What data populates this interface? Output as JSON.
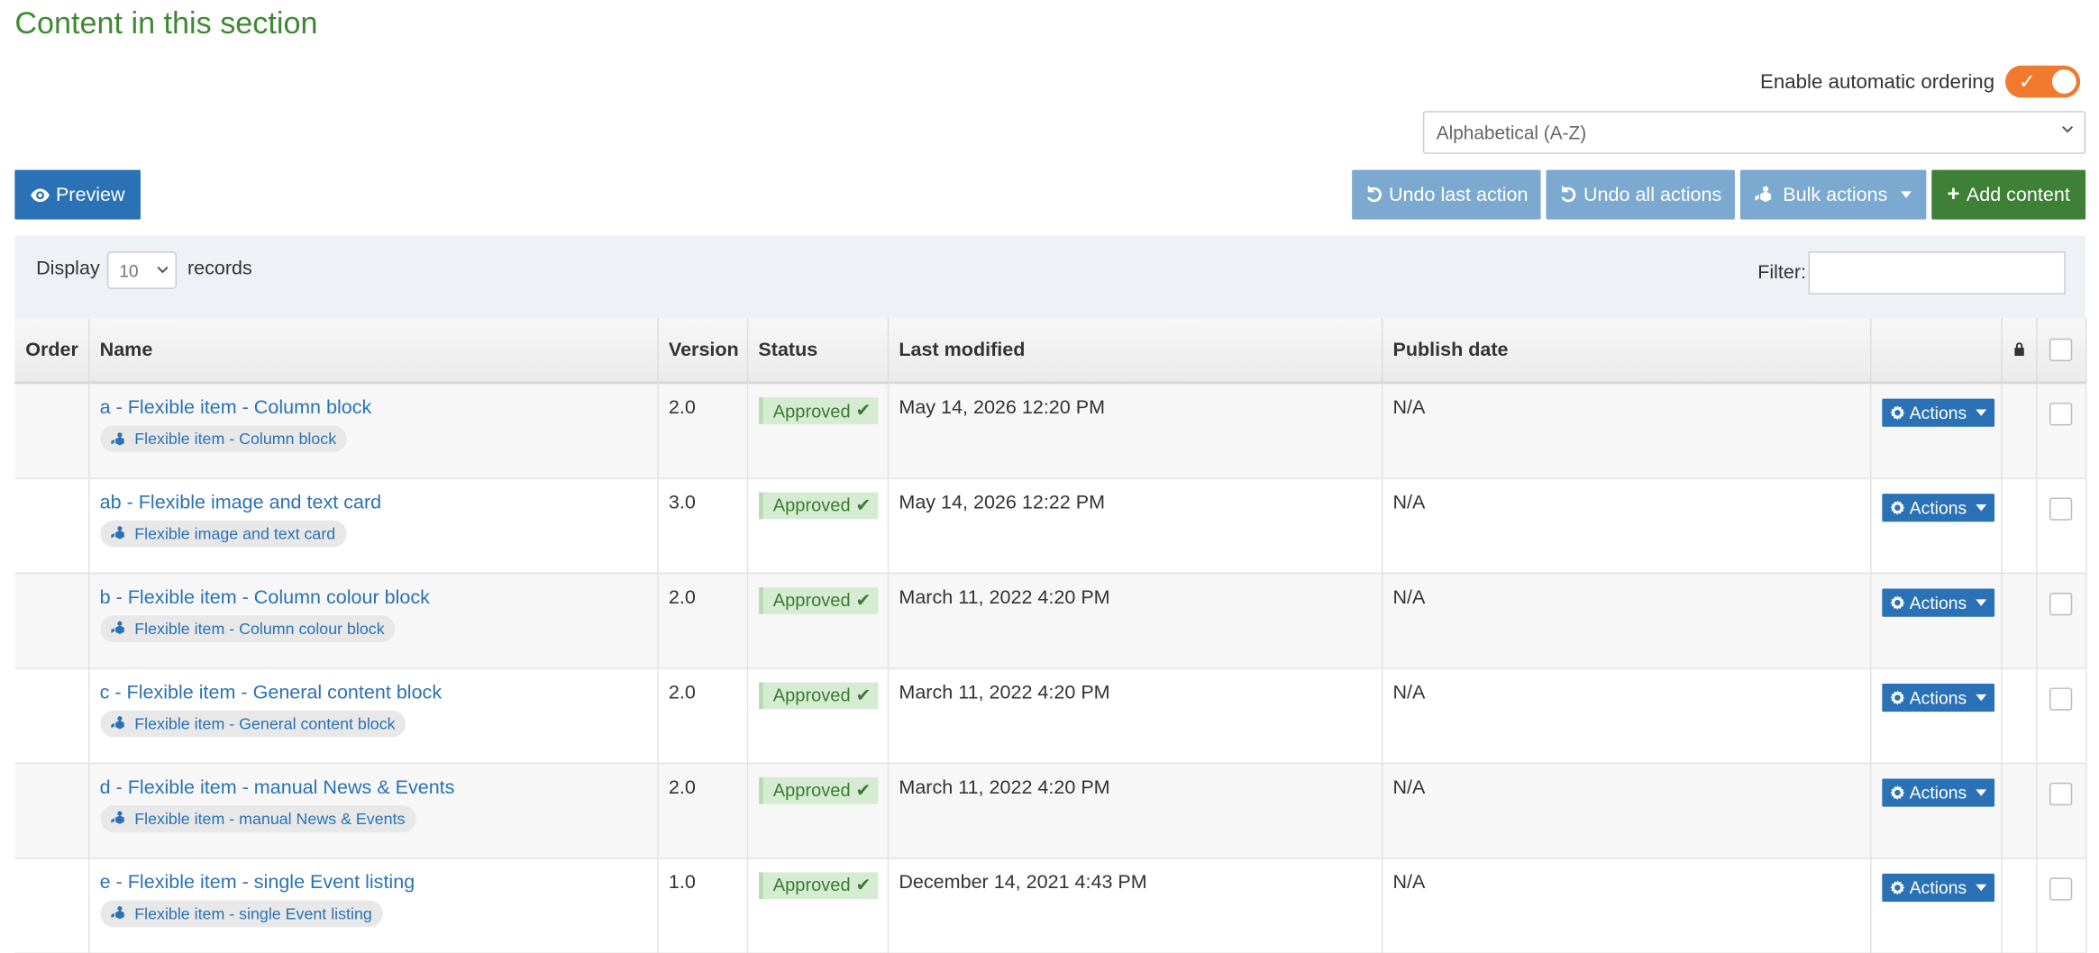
{
  "title": "Content in this section",
  "ordering": {
    "label": "Enable automatic ordering",
    "enabled": true,
    "sort_value": "Alphabetical (A-Z)"
  },
  "toolbar": {
    "preview": "Preview",
    "undo_last": "Undo last action",
    "undo_all": "Undo all actions",
    "bulk": "Bulk actions",
    "add": "Add content"
  },
  "filterbar": {
    "display_label": "Display",
    "display_value": "10",
    "records_label": "records",
    "filter_label": "Filter:"
  },
  "columns": {
    "order": "Order",
    "name": "Name",
    "version": "Version",
    "status": "Status",
    "modified": "Last modified",
    "publish": "Publish date"
  },
  "rows": [
    {
      "name": "a - Flexible item - Column block",
      "type": "Flexible item - Column block",
      "version": "2.0",
      "status": "Approved",
      "modified": "May 14, 2026 12:20 PM",
      "publish": "N/A",
      "actions": "Actions"
    },
    {
      "name": "ab - Flexible image and text card",
      "type": "Flexible image and text card",
      "version": "3.0",
      "status": "Approved",
      "modified": "May 14, 2026 12:22 PM",
      "publish": "N/A",
      "actions": "Actions"
    },
    {
      "name": "b - Flexible item - Column colour block",
      "type": "Flexible item - Column colour block",
      "version": "2.0",
      "status": "Approved",
      "modified": "March 11, 2022 4:20 PM",
      "publish": "N/A",
      "actions": "Actions"
    },
    {
      "name": "c - Flexible item - General content block",
      "type": "Flexible item - General content block",
      "version": "2.0",
      "status": "Approved",
      "modified": "March 11, 2022 4:20 PM",
      "publish": "N/A",
      "actions": "Actions"
    },
    {
      "name": "d - Flexible item - manual News & Events",
      "type": "Flexible item - manual News & Events",
      "version": "2.0",
      "status": "Approved",
      "modified": "March 11, 2022 4:20 PM",
      "publish": "N/A",
      "actions": "Actions"
    },
    {
      "name": "e - Flexible item - single Event listing",
      "type": "Flexible item - single Event listing",
      "version": "1.0",
      "status": "Approved",
      "modified": "December 14, 2021 4:43 PM",
      "publish": "N/A",
      "actions": "Actions"
    }
  ],
  "colors": {
    "title_green": "#3d8a32",
    "primary_blue": "#2a72b5",
    "muted_blue": "#7ca9cf",
    "add_green": "#3f8037",
    "toggle_orange": "#f07a2e",
    "approved_bg": "#d5ecd2"
  }
}
